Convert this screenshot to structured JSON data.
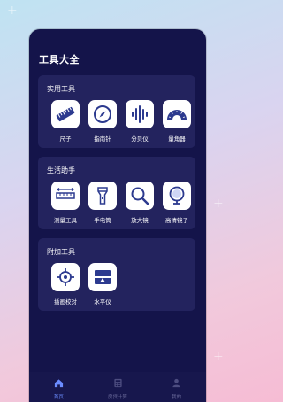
{
  "app": {
    "title": "工具大全"
  },
  "sections": [
    {
      "title": "实用工具",
      "tools": [
        {
          "label": "尺子",
          "icon": "ruler-icon"
        },
        {
          "label": "指南针",
          "icon": "compass-icon"
        },
        {
          "label": "分贝仪",
          "icon": "sound-wave-icon"
        },
        {
          "label": "量角器",
          "icon": "protractor-icon"
        }
      ]
    },
    {
      "title": "生活助手",
      "tools": [
        {
          "label": "测量工具",
          "icon": "measure-icon"
        },
        {
          "label": "手电筒",
          "icon": "flashlight-icon"
        },
        {
          "label": "放大镜",
          "icon": "magnifier-icon"
        },
        {
          "label": "高清镜子",
          "icon": "mirror-icon"
        }
      ]
    },
    {
      "title": "附加工具",
      "tools": [
        {
          "label": "插画校对",
          "icon": "crosshair-icon"
        },
        {
          "label": "水平仪",
          "icon": "level-icon"
        }
      ]
    }
  ],
  "tabbar": {
    "items": [
      {
        "label": "首页",
        "icon": "home-icon",
        "active": true
      },
      {
        "label": "房贷计算",
        "icon": "calculator-icon",
        "active": false
      },
      {
        "label": "我的",
        "icon": "user-icon",
        "active": false
      }
    ]
  },
  "colors": {
    "accent": "#6b8cff",
    "icon_blue": "#2c3a8f",
    "card_bg": "#23235e",
    "phone_bg": "#14144a"
  }
}
